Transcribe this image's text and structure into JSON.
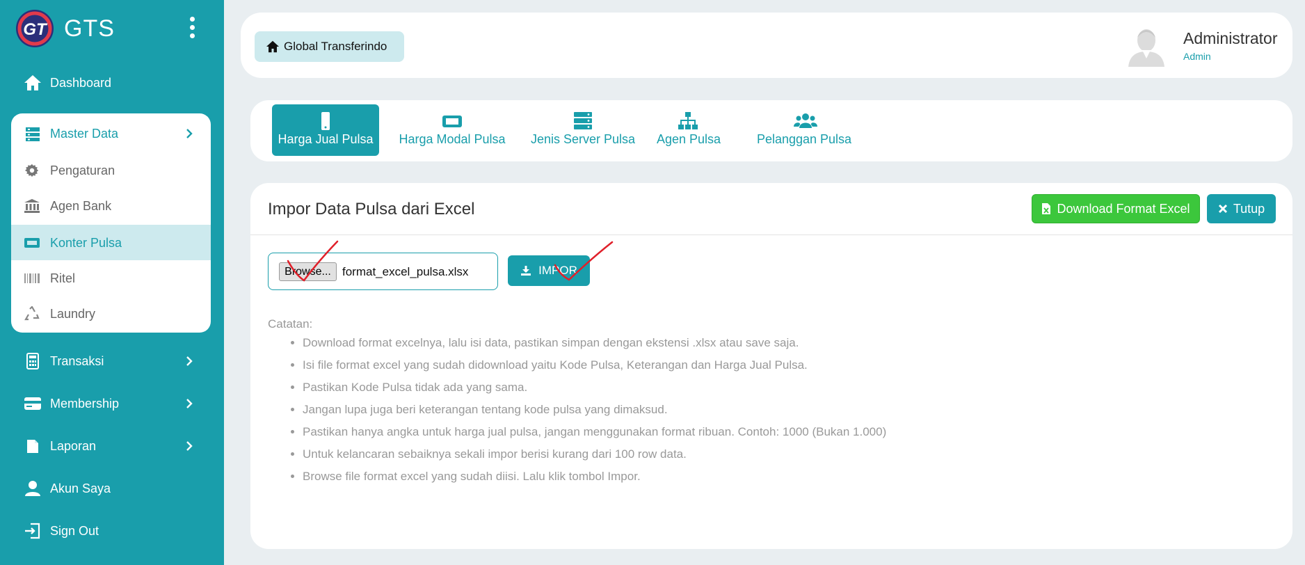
{
  "app": {
    "name": "GTS",
    "logo_text": "GT"
  },
  "sidebar": {
    "dashboard": "Dashboard",
    "master_data": {
      "label": "Master Data",
      "items": [
        {
          "label": "Pengaturan",
          "icon": "gear-icon"
        },
        {
          "label": "Agen Bank",
          "icon": "bank-icon"
        },
        {
          "label": "Konter Pulsa",
          "icon": "ticket-icon",
          "active": true
        },
        {
          "label": "Ritel",
          "icon": "barcode-icon"
        },
        {
          "label": "Laundry",
          "icon": "recycle-icon"
        }
      ]
    },
    "transaksi": "Transaksi",
    "membership": "Membership",
    "laporan": "Laporan",
    "akun_saya": "Akun Saya",
    "sign_out": "Sign Out"
  },
  "header": {
    "breadcrumb": "Global Transferindo",
    "user_name": "Administrator",
    "user_role": "Admin"
  },
  "tabs": [
    {
      "label": "Harga Jual Pulsa",
      "icon": "mobile-icon",
      "active": true
    },
    {
      "label": "Harga Modal Pulsa",
      "icon": "ticket-icon"
    },
    {
      "label": "Jenis Server Pulsa",
      "icon": "server-icon"
    },
    {
      "label": "Agen Pulsa",
      "icon": "sitemap-icon"
    },
    {
      "label": "Pelanggan Pulsa",
      "icon": "users-icon"
    }
  ],
  "panel": {
    "title": "Impor Data Pulsa dari Excel",
    "download_button": "Download Format Excel",
    "close_button": "Tutup",
    "browse_button": "Browse...",
    "file_name": "format_excel_pulsa.xlsx",
    "import_button": "IMPOR",
    "note_title": "Catatan:",
    "notes": [
      "Download format excelnya, lalu isi data, pastikan simpan dengan ekstensi .xlsx atau save saja.",
      "Isi file format excel yang sudah didownload yaitu Kode Pulsa, Keterangan dan Harga Jual Pulsa.",
      "Pastikan Kode Pulsa tidak ada yang sama.",
      "Jangan lupa juga beri keterangan tentang kode pulsa yang dimaksud.",
      "Pastikan hanya angka untuk harga jual pulsa, jangan menggunakan format ribuan. Contoh: 1000 (Bukan 1.000)",
      "Untuk kelancaran sebaiknya sekali impor berisi kurang dari 100 row data.",
      "Browse file format excel yang sudah diisi. Lalu klik tombol Impor."
    ]
  },
  "colors": {
    "accent": "#199eab",
    "success": "#3cc73c",
    "annotation": "#e0202a"
  }
}
